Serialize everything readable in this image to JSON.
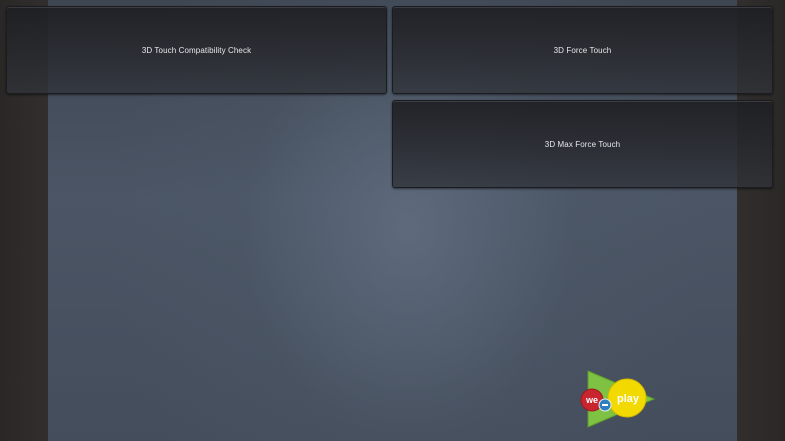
{
  "menu": {
    "items": [
      {
        "label": "3D Touch Compatibility Check"
      },
      {
        "label": "3D Force Touch"
      },
      {
        "label": "3D Max Force Touch"
      }
    ]
  },
  "logo": {
    "word_we": "we",
    "word_play": "play",
    "icon": "weplay-logo-icon",
    "colors": {
      "triangle": "#7fc243",
      "we_circle": "#c8252f",
      "play_circle": "#f2d900",
      "gamepad": "#2f7fc1"
    }
  },
  "theme": {
    "background": "#4b5565",
    "side_panel": "#2c2a29",
    "tile": "#2a2c31",
    "tile_text": "#e6e8ea"
  }
}
